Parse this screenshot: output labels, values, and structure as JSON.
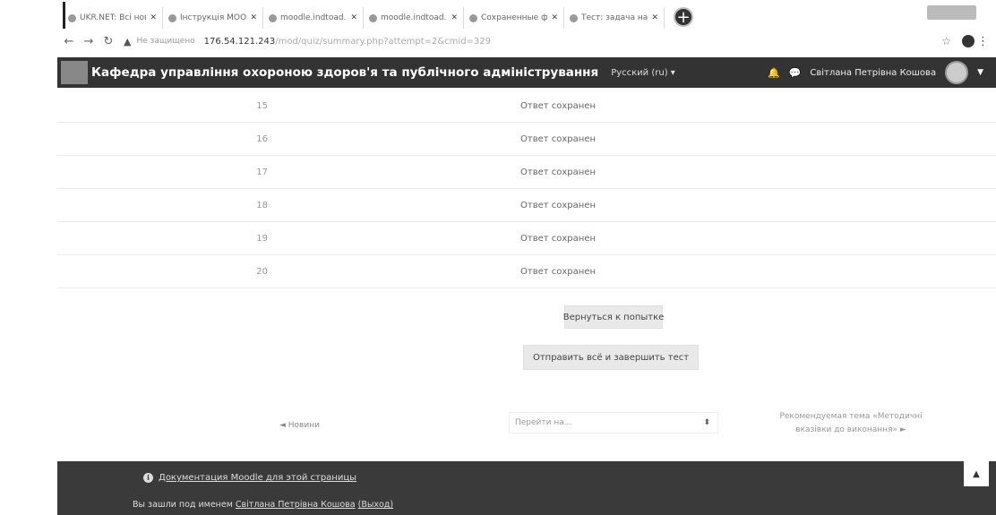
{
  "browser": {
    "tabs": [
      {
        "title": "UKR.NET: Всі новини"
      },
      {
        "title": "Інструкція MOODLE"
      },
      {
        "title": "moodle.indtoad.pa.ru"
      },
      {
        "title": "moodle.indtoad.pa.ru"
      },
      {
        "title": "Сохраненные файлы"
      },
      {
        "title": "Тест: задача на по..."
      }
    ],
    "security_label": "Не защищено",
    "url": "176.54.121.243",
    "url_rest": "/mod/quiz/summary.php?attempt=2&cmid=329"
  },
  "navbar": {
    "site_name": "Кафедра управління охороною здоров'я та публічного адміністрування",
    "language": "Русский (ru) ▾",
    "user_name": "Світлана Петрівна Кошова"
  },
  "summary": {
    "rows": [
      {
        "number": "15",
        "status": "Ответ сохранен"
      },
      {
        "number": "16",
        "status": "Ответ сохранен"
      },
      {
        "number": "17",
        "status": "Ответ сохранен"
      },
      {
        "number": "18",
        "status": "Ответ сохранен"
      },
      {
        "number": "19",
        "status": "Ответ сохранен"
      },
      {
        "number": "20",
        "status": "Ответ сохранен"
      }
    ],
    "return_button": "Вернуться к попытке",
    "submit_button": "Отправить всё и завершить тест"
  },
  "activity_nav": {
    "prev_link": "◄ Новини",
    "jump_placeholder": "Перейти на...",
    "next_link_line1": "Рекомендуемая тема «Методичні",
    "next_link_line2": "вказівки до виконання» ►"
  },
  "footer": {
    "docs_link": "Документация Moodle для этой страницы",
    "login_prefix": "Вы зашли под именем",
    "login_user": "Світлана Петрівна Кошова",
    "logout_link": "(Выход)"
  }
}
